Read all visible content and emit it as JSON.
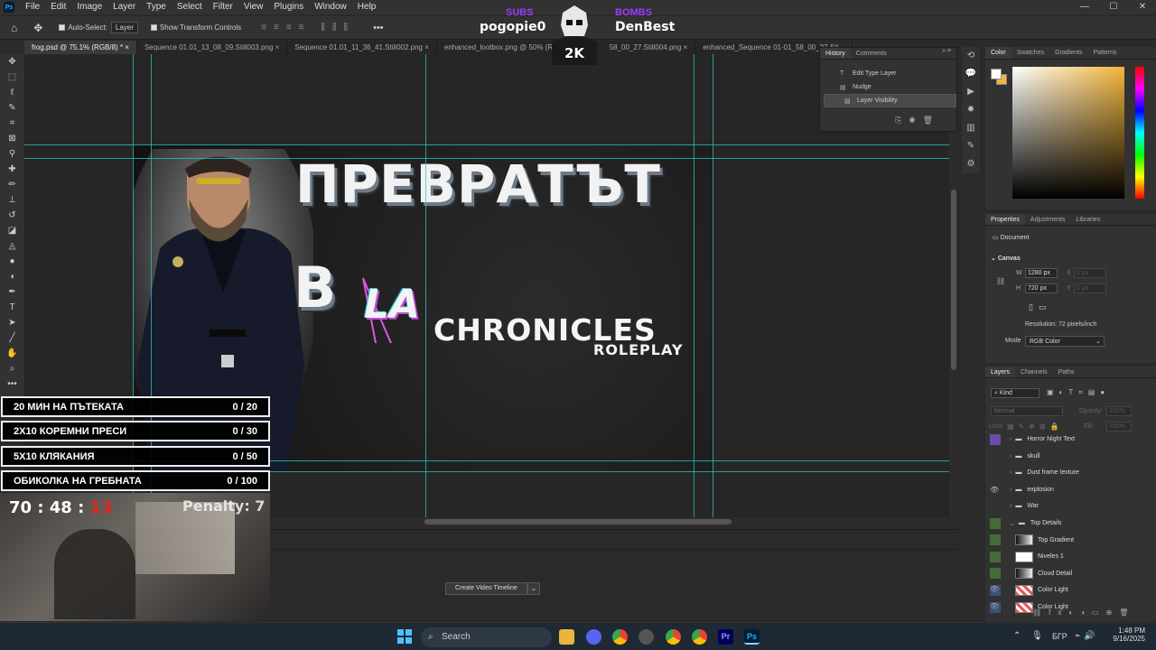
{
  "menubar": {
    "app_icon": "Ps",
    "items": [
      "File",
      "Edit",
      "Image",
      "Layer",
      "Type",
      "Select",
      "Filter",
      "View",
      "Plugins",
      "Window",
      "Help"
    ]
  },
  "options_bar": {
    "auto_select_label": "Auto-Select:",
    "auto_select_target": "Layer",
    "show_transform_label": "Show Transform Controls",
    "more": "•••"
  },
  "tabs": [
    {
      "label": "frog.psd @ 75.1% (RGB/8) *"
    },
    {
      "label": "Sequence 01.01_13_08_09.Still003.png"
    },
    {
      "label": "Sequence 01.01_11_36_41.Still002.png"
    },
    {
      "label": "enhanced_lootbox.png @ 50% (R..."
    },
    {
      "label": "58_00_27.Still004.png"
    },
    {
      "label": "enhanced_Sequence 01-01_58_00_27-Sti..."
    }
  ],
  "overlay_top": {
    "left_label": "SUBS",
    "left_name": "pogopie0",
    "badge": "2K",
    "right_label": "BOMBS",
    "right_name": "DenBest"
  },
  "document": {
    "headline_1": "ПРЕВРАТЪТ",
    "headline_2": "В",
    "logo_mark": "LA",
    "logo_word": "CHRONICLES",
    "logo_sub": "ROLEPLAY"
  },
  "history": {
    "tabs": [
      "History",
      "Comments"
    ],
    "rows": [
      {
        "icon": "text-layer-icon",
        "label": "Edit Type Layer"
      },
      {
        "icon": "layer-icon",
        "label": "Nudge"
      },
      {
        "icon": "layer-icon",
        "label": "Layer Visibility"
      }
    ]
  },
  "color_panel": {
    "tabs": [
      "Color",
      "Swatches",
      "Gradients",
      "Patterns"
    ],
    "foreground": "#ffffff",
    "background": "#f2b63a"
  },
  "properties": {
    "tabs": [
      "Properties",
      "Adjustments",
      "Libraries"
    ],
    "doc_label": "Document",
    "canvas_title": "Canvas",
    "w_label": "W",
    "w_value": "1280 px",
    "h_label": "H",
    "h_value": "720 px",
    "x_label": "X",
    "x_value": "0 px",
    "y_label": "Y",
    "y_value": "0 px",
    "resolution": "Resolution: 72 pixels/inch",
    "mode_label": "Mode",
    "mode_value": "RGB Color"
  },
  "layers": {
    "tabs": [
      "Layers",
      "Channels",
      "Paths"
    ],
    "filter_label": "Kind",
    "blend_mode": "Normal",
    "opacity_label": "Opacity:",
    "opacity_value": "100%",
    "lock_label": "Lock:",
    "fill_label": "Fill:",
    "fill_value": "100%",
    "rows": [
      {
        "label": "Horror Night Text",
        "type": "group",
        "color": "#7a50c8",
        "eye": false
      },
      {
        "label": "skull",
        "type": "group",
        "color": "",
        "eye": false
      },
      {
        "label": "Dust frame texture",
        "type": "group",
        "color": "",
        "eye": false
      },
      {
        "label": "explosion",
        "type": "group",
        "color": "",
        "eye": true
      },
      {
        "label": "War",
        "type": "group",
        "color": "",
        "eye": false
      },
      {
        "label": "Top Details",
        "type": "group-open",
        "color": "#4a7a3a",
        "eye": false
      },
      {
        "label": "Top Gradient",
        "type": "layer",
        "color": "#4a7a3a",
        "eye": false
      },
      {
        "label": "Niveles 1",
        "type": "adjustment",
        "color": "#4a7a3a",
        "eye": false
      },
      {
        "label": "Cloud Detail",
        "type": "layer",
        "color": "#4a7a3a",
        "eye": false
      },
      {
        "label": "Color Light",
        "type": "layer",
        "color": "#3a5a8a",
        "eye": true
      },
      {
        "label": "Color Light",
        "type": "layer",
        "color": "#3a5a8a",
        "eye": true
      }
    ]
  },
  "timeline": {
    "create_button": "Create Video Timeline"
  },
  "challenge": {
    "goals": [
      {
        "label": "20 МИН НА ПЪТЕКАТА",
        "progress": "0 / 20"
      },
      {
        "label": "2X10 КОРЕМНИ ПРЕСИ",
        "progress": "0 / 30"
      },
      {
        "label": "5X10 КЛЯКАНИЯ",
        "progress": "0 / 50"
      },
      {
        "label": "ОБИКОЛКА НА ГРЕБНАТА",
        "progress": "0 / 100"
      }
    ],
    "timer_main": "70 : 48 :",
    "timer_seconds": "13",
    "penalty": "Penalty: 7"
  },
  "taskbar": {
    "search_label": "Search",
    "language": "БГР",
    "time": "1:48 PM",
    "date": "9/16/2025"
  }
}
